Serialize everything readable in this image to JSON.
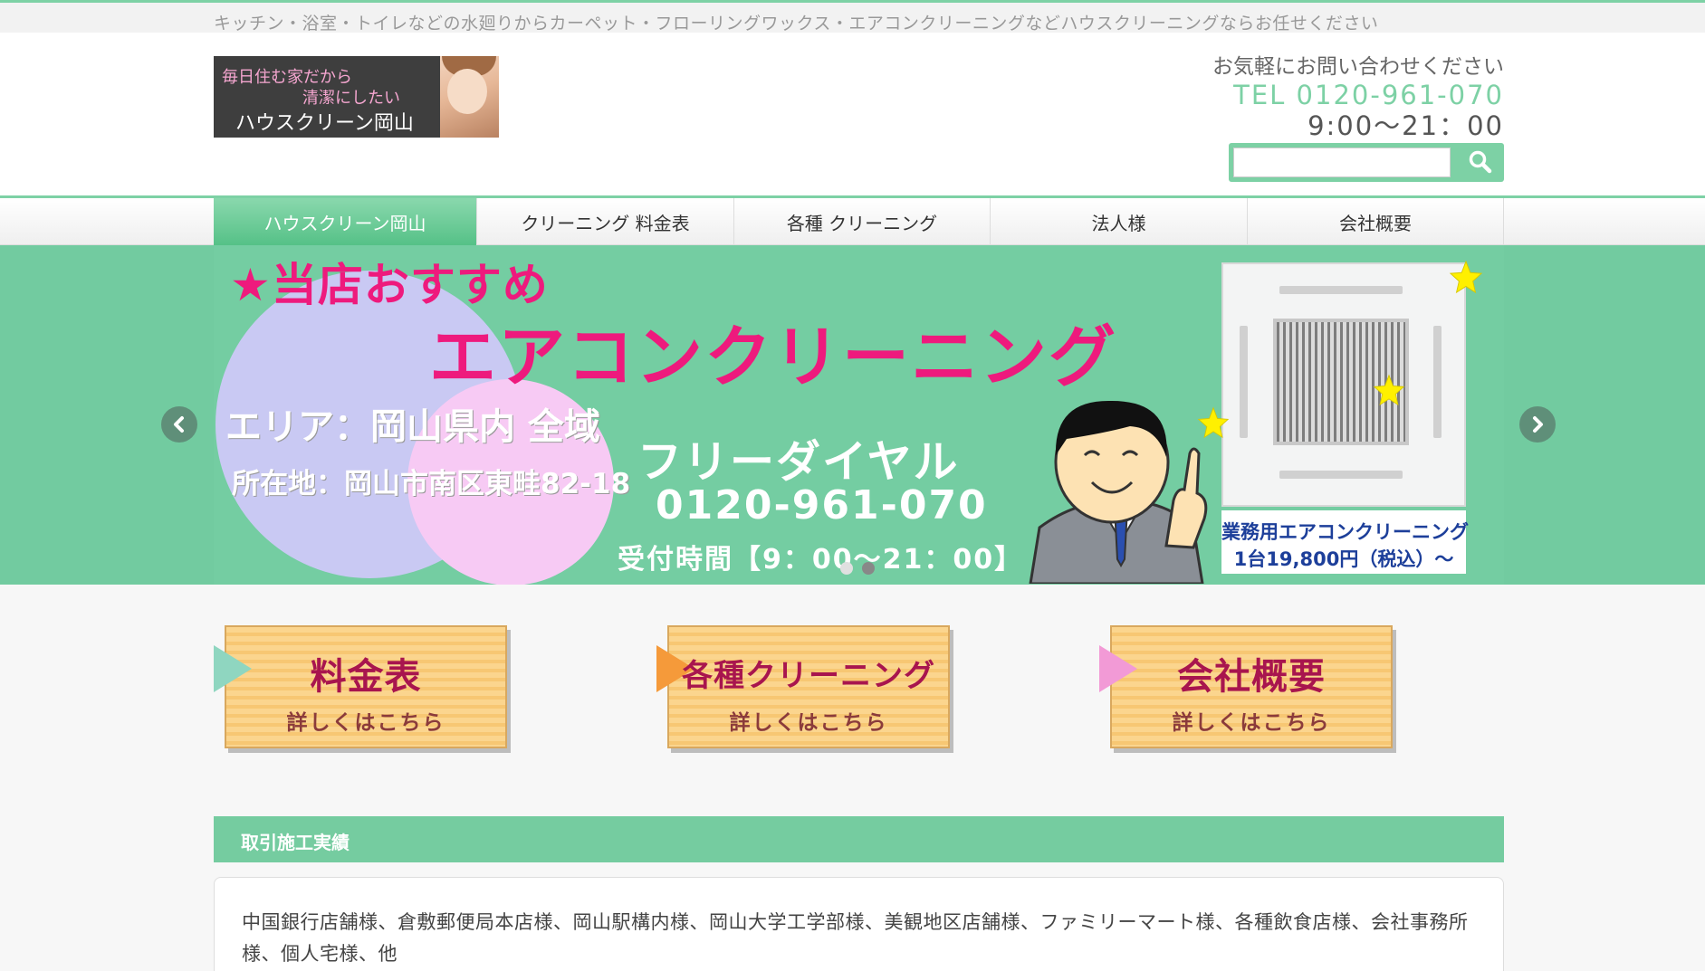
{
  "tagline": "キッチン・浴室・トイレなどの水廻りからカーペット・フローリングワックス・エアコンクリーニングなどハウスクリーニングならお任せください",
  "logo": {
    "line1": "毎日住む家だから",
    "line2": "清潔にしたい",
    "line3": "ハウスクリーン岡山"
  },
  "contact": {
    "ask": "お気軽にお問い合わせください",
    "tel": "TEL 0120-961-070",
    "hours": "9:00～21：00"
  },
  "search": {
    "placeholder": "",
    "value": "",
    "icon": "search-icon"
  },
  "nav": [
    {
      "label": "ハウスクリーン岡山",
      "active": true
    },
    {
      "label": "クリーニング 料金表",
      "active": false
    },
    {
      "label": "各種 クリーニング",
      "active": false
    },
    {
      "label": "法人様",
      "active": false
    },
    {
      "label": "会社概要",
      "active": false
    }
  ],
  "slider": {
    "recommend": "★当店おすすめ",
    "service": "エアコンクリーニング",
    "area": "エリア：岡山県内 全域",
    "address": "所在地：岡山市南区東畦82-18",
    "freedial": "フリーダイヤル",
    "number": "0120-961-070",
    "hours": "受付時間【9：00～21：00】",
    "ac_caption1": "業務用エアコンクリーニング",
    "ac_caption2": "1台19,800円（税込）～",
    "prev_icon": "chevron-left-icon",
    "next_icon": "chevron-right-icon",
    "dots": 2,
    "active_dot": 2
  },
  "buttons": [
    {
      "title": "料金表",
      "sub": "詳しくはこちら",
      "accent": "#8fd6c0"
    },
    {
      "title": "各種クリーニング",
      "sub": "詳しくはこちら",
      "accent": "#f59a3a"
    },
    {
      "title": "会社概要",
      "sub": "詳しくはこちら",
      "accent": "#f29ad6"
    }
  ],
  "section": {
    "title": "取引施工実績",
    "body": "中国銀行店舗様、倉敷郵便局本店様、岡山駅構内様、岡山大学工学部様、美観地区店舗様、ファミリーマート様、各種飲食店様、会社事務所様、個人宅様、他"
  },
  "colors": {
    "accent": "#7dd1a5",
    "pink": "#ee1a7d"
  }
}
